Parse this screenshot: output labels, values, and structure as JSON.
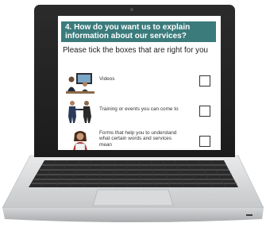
{
  "question": {
    "title_line1": "4. How do you want us to explain",
    "title_line2": "information about our services?",
    "instruction": "Please tick the boxes that are right for you"
  },
  "options": [
    {
      "label": "Videos",
      "checked": false,
      "icon": "video-meeting-icon"
    },
    {
      "label": "Training or events you can come to",
      "checked": false,
      "icon": "handshake-icon"
    },
    {
      "label_line1": "Forms that help you to understand",
      "label_line2": "what certain words and services",
      "label_line3": "mean",
      "checked": false,
      "icon": "reading-person-icon"
    }
  ],
  "colors": {
    "header_bg": "#3b7b7c",
    "header_text": "#ffffff",
    "bezel": "#1c1c1c",
    "body": "#d8d9da"
  }
}
